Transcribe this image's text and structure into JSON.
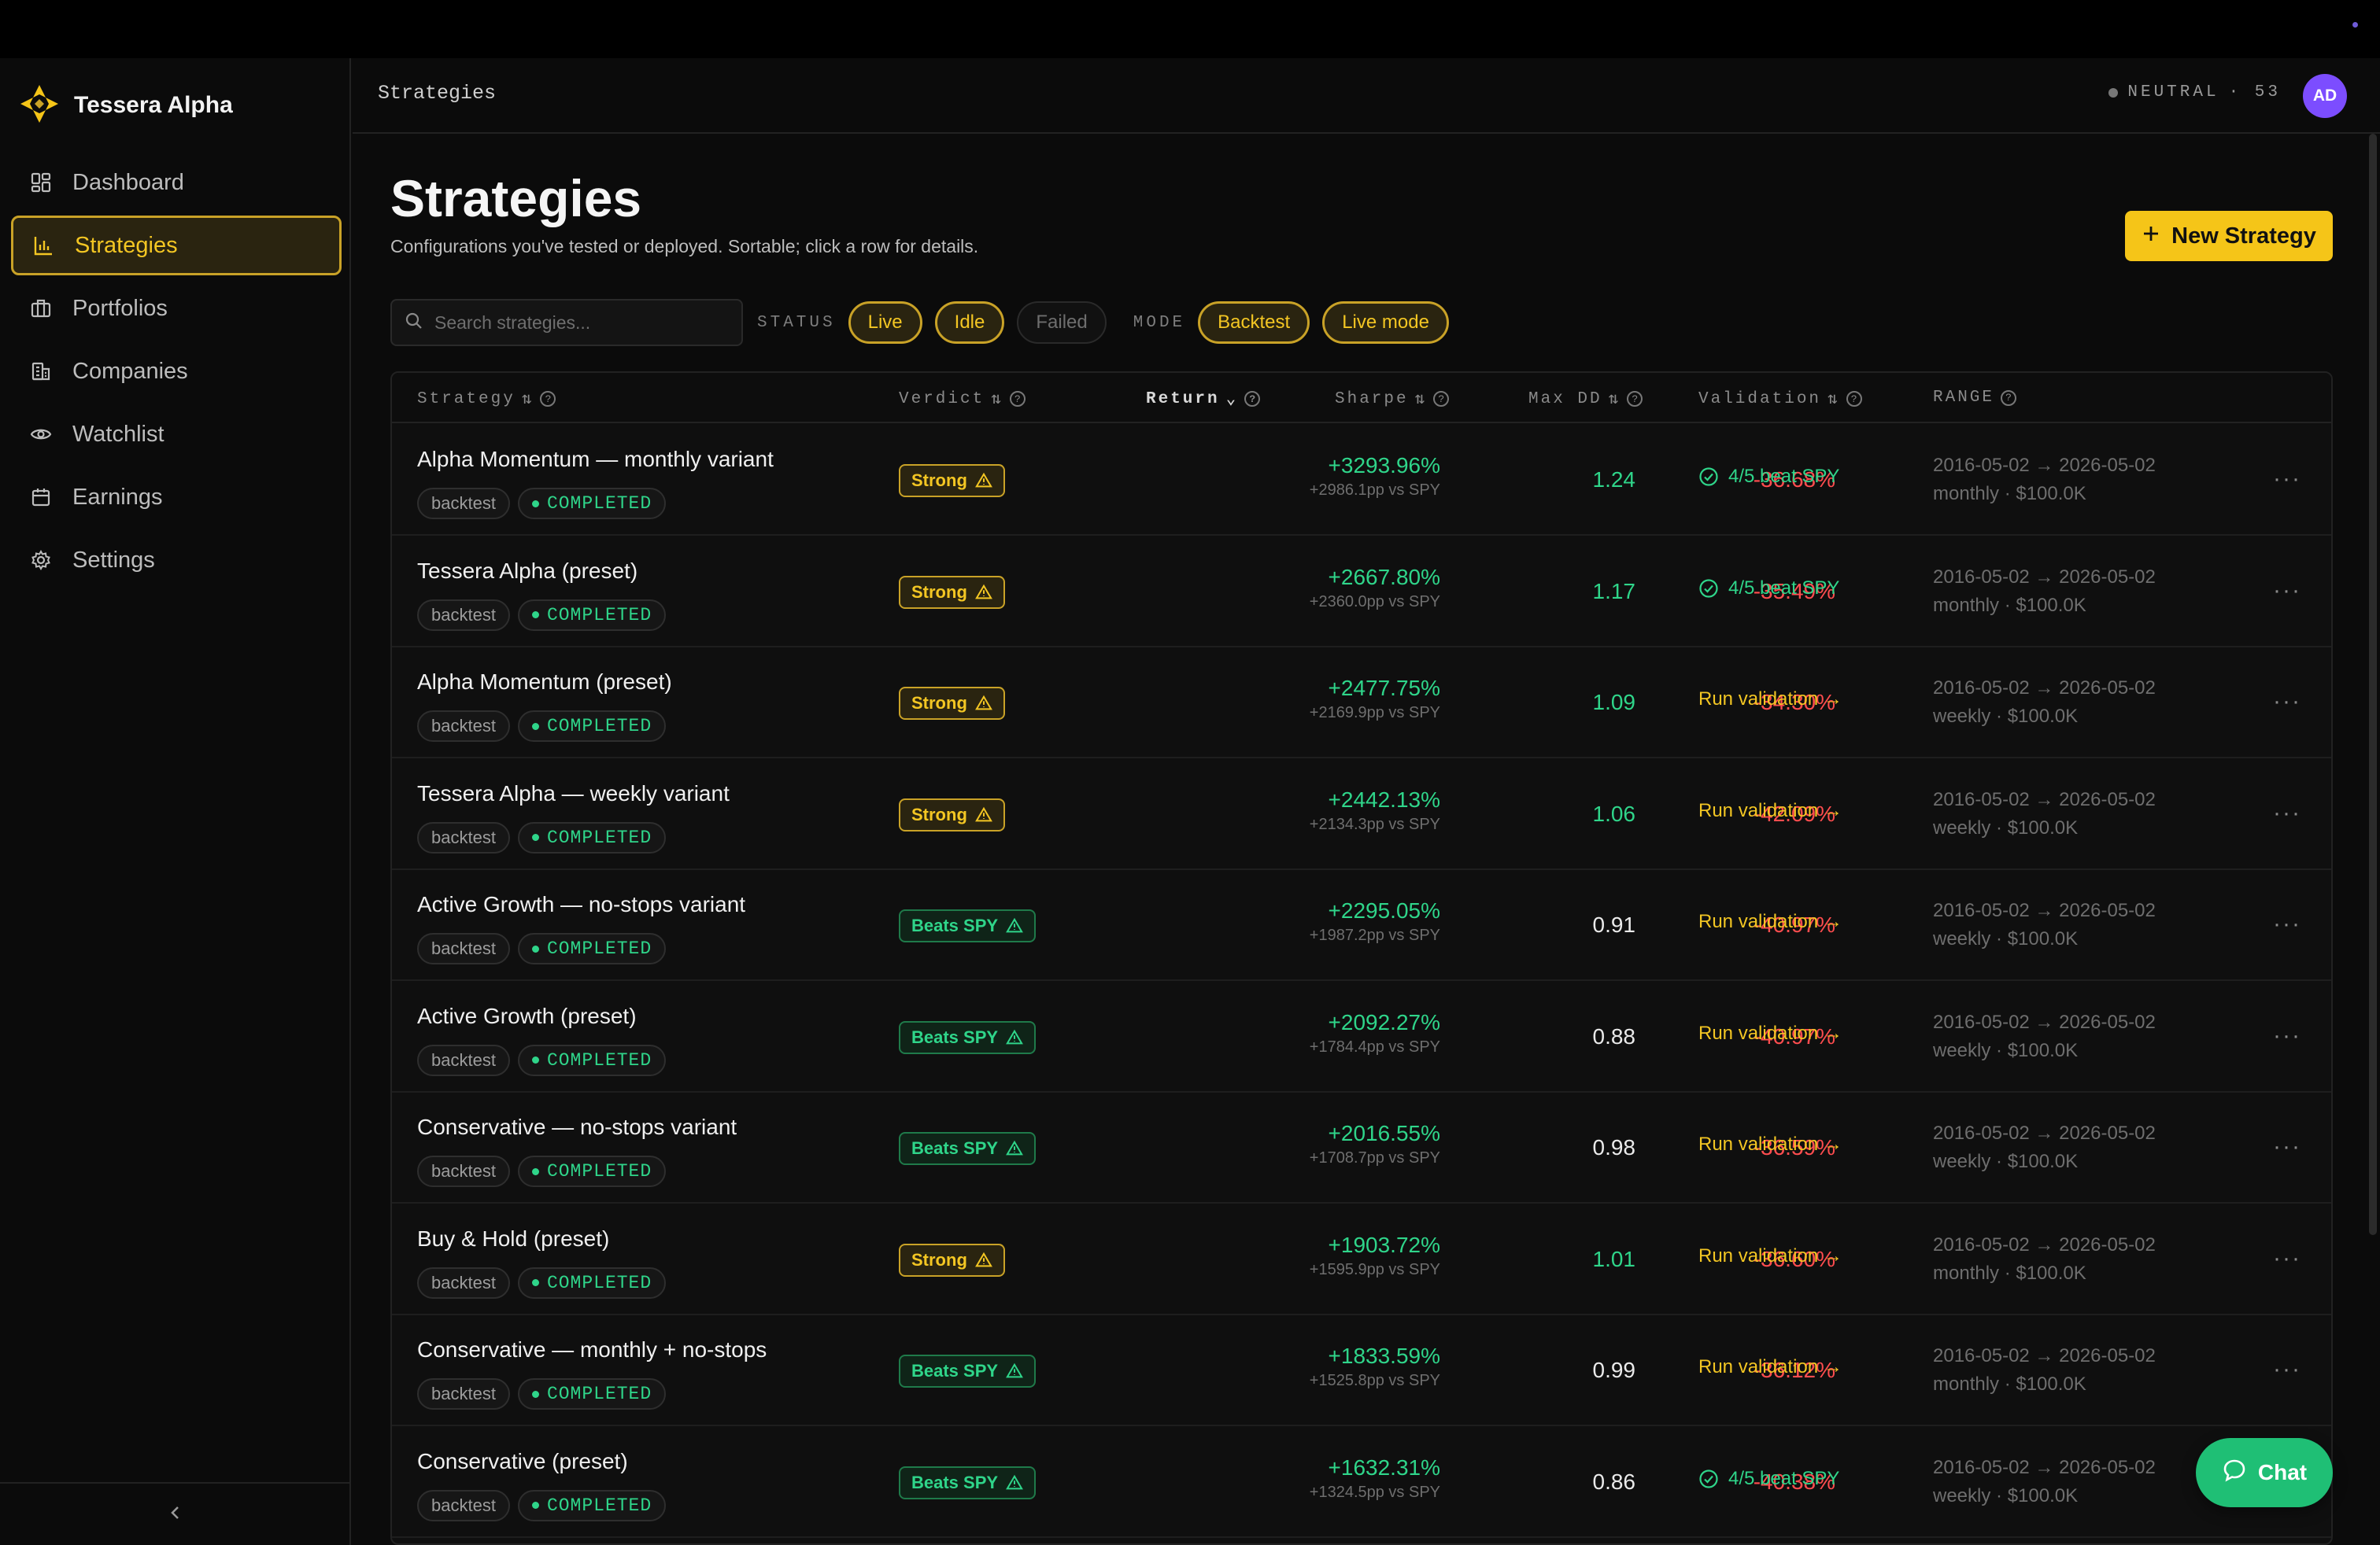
{
  "app": {
    "name": "Tessera Alpha"
  },
  "sidebar": {
    "items": [
      {
        "label": "Dashboard",
        "icon": "dashboard-icon",
        "active": false
      },
      {
        "label": "Strategies",
        "icon": "bar-chart-icon",
        "active": true
      },
      {
        "label": "Portfolios",
        "icon": "briefcase-icon",
        "active": false
      },
      {
        "label": "Companies",
        "icon": "building-icon",
        "active": false
      },
      {
        "label": "Watchlist",
        "icon": "eye-icon",
        "active": false
      },
      {
        "label": "Earnings",
        "icon": "calendar-icon",
        "active": false
      },
      {
        "label": "Settings",
        "icon": "gear-icon",
        "active": false
      }
    ]
  },
  "header": {
    "breadcrumb": "Strategies",
    "regime_label": "NEUTRAL",
    "regime_score": "· 53",
    "avatar_initials": "AD"
  },
  "page": {
    "title": "Strategies",
    "subtitle": "Configurations you've tested or deployed. Sortable; click a row for details.",
    "new_button": "New Strategy"
  },
  "filters": {
    "search_placeholder": "Search strategies...",
    "status_label": "STATUS",
    "status_chips": [
      {
        "label": "Live",
        "on": true
      },
      {
        "label": "Idle",
        "on": true
      },
      {
        "label": "Failed",
        "on": false
      }
    ],
    "mode_label": "MODE",
    "mode_chips": [
      {
        "label": "Backtest",
        "on": true
      },
      {
        "label": "Live mode",
        "on": true
      }
    ]
  },
  "table": {
    "columns": [
      "Strategy",
      "Verdict",
      "Return",
      "Sharpe",
      "Max DD",
      "Validation",
      "RANGE"
    ],
    "rows": [
      {
        "name": "Alpha Momentum — monthly variant",
        "mode": "backtest",
        "status": "COMPLETED",
        "verdict": "Strong",
        "verdict_kind": "strong",
        "return": "+3293.96%",
        "vs_spy": "+2986.1pp vs SPY",
        "sharpe": "1.24",
        "sharpe_kind": "g",
        "max_dd": "-36.68%",
        "validation": "4/5 beat SPY",
        "validation_kind": "ok",
        "range_dates": "2016-05-02 → 2026-05-02",
        "range_detail": "monthly · $100.0K"
      },
      {
        "name": "Tessera Alpha (preset)",
        "mode": "backtest",
        "status": "COMPLETED",
        "verdict": "Strong",
        "verdict_kind": "strong",
        "return": "+2667.80%",
        "vs_spy": "+2360.0pp vs SPY",
        "sharpe": "1.17",
        "sharpe_kind": "g",
        "max_dd": "-35.49%",
        "validation": "4/5 beat SPY",
        "validation_kind": "ok",
        "range_dates": "2016-05-02 → 2026-05-02",
        "range_detail": "monthly · $100.0K"
      },
      {
        "name": "Alpha Momentum (preset)",
        "mode": "backtest",
        "status": "COMPLETED",
        "verdict": "Strong",
        "verdict_kind": "strong",
        "return": "+2477.75%",
        "vs_spy": "+2169.9pp vs SPY",
        "sharpe": "1.09",
        "sharpe_kind": "g",
        "max_dd": "-34.30%",
        "validation": "Run validation →",
        "validation_kind": "run",
        "range_dates": "2016-05-02 → 2026-05-02",
        "range_detail": "weekly · $100.0K"
      },
      {
        "name": "Tessera Alpha — weekly variant",
        "mode": "backtest",
        "status": "COMPLETED",
        "verdict": "Strong",
        "verdict_kind": "strong",
        "return": "+2442.13%",
        "vs_spy": "+2134.3pp vs SPY",
        "sharpe": "1.06",
        "sharpe_kind": "g",
        "max_dd": "-42.09%",
        "validation": "Run validation →",
        "validation_kind": "run",
        "range_dates": "2016-05-02 → 2026-05-02",
        "range_detail": "weekly · $100.0K"
      },
      {
        "name": "Active Growth — no-stops variant",
        "mode": "backtest",
        "status": "COMPLETED",
        "verdict": "Beats SPY",
        "verdict_kind": "beats",
        "return": "+2295.05%",
        "vs_spy": "+1987.2pp vs SPY",
        "sharpe": "0.91",
        "sharpe_kind": "w",
        "max_dd": "-40.97%",
        "validation": "Run validation →",
        "validation_kind": "run",
        "range_dates": "2016-05-02 → 2026-05-02",
        "range_detail": "weekly · $100.0K"
      },
      {
        "name": "Active Growth (preset)",
        "mode": "backtest",
        "status": "COMPLETED",
        "verdict": "Beats SPY",
        "verdict_kind": "beats",
        "return": "+2092.27%",
        "vs_spy": "+1784.4pp vs SPY",
        "sharpe": "0.88",
        "sharpe_kind": "w",
        "max_dd": "-40.97%",
        "validation": "Run validation →",
        "validation_kind": "run",
        "range_dates": "2016-05-02 → 2026-05-02",
        "range_detail": "weekly · $100.0K"
      },
      {
        "name": "Conservative — no-stops variant",
        "mode": "backtest",
        "status": "COMPLETED",
        "verdict": "Beats SPY",
        "verdict_kind": "beats",
        "return": "+2016.55%",
        "vs_spy": "+1708.7pp vs SPY",
        "sharpe": "0.98",
        "sharpe_kind": "w",
        "max_dd": "-36.59%",
        "validation": "Run validation →",
        "validation_kind": "run",
        "range_dates": "2016-05-02 → 2026-05-02",
        "range_detail": "weekly · $100.0K"
      },
      {
        "name": "Buy & Hold (preset)",
        "mode": "backtest",
        "status": "COMPLETED",
        "verdict": "Strong",
        "verdict_kind": "strong",
        "return": "+1903.72%",
        "vs_spy": "+1595.9pp vs SPY",
        "sharpe": "1.01",
        "sharpe_kind": "g",
        "max_dd": "-36.60%",
        "validation": "Run validation →",
        "validation_kind": "run",
        "range_dates": "2016-05-02 → 2026-05-02",
        "range_detail": "monthly · $100.0K"
      },
      {
        "name": "Conservative — monthly + no-stops",
        "mode": "backtest",
        "status": "COMPLETED",
        "verdict": "Beats SPY",
        "verdict_kind": "beats",
        "return": "+1833.59%",
        "vs_spy": "+1525.8pp vs SPY",
        "sharpe": "0.99",
        "sharpe_kind": "w",
        "max_dd": "-36.12%",
        "validation": "Run validation →",
        "validation_kind": "run",
        "range_dates": "2016-05-02 → 2026-05-02",
        "range_detail": "monthly · $100.0K"
      },
      {
        "name": "Conservative (preset)",
        "mode": "backtest",
        "status": "COMPLETED",
        "verdict": "Beats SPY",
        "verdict_kind": "beats",
        "return": "+1632.31%",
        "vs_spy": "+1324.5pp vs SPY",
        "sharpe": "0.86",
        "sharpe_kind": "w",
        "max_dd": "-40.38%",
        "validation": "4/5 beat SPY",
        "validation_kind": "ok",
        "range_dates": "2016-05-02 → 2026-05-02",
        "range_detail": "weekly · $100.0K"
      }
    ]
  },
  "chat": {
    "label": "Chat"
  },
  "colors": {
    "accent": "#f5c518",
    "positive": "#2fd58a",
    "negative": "#ff4d4f",
    "avatar": "#7c4dff"
  }
}
